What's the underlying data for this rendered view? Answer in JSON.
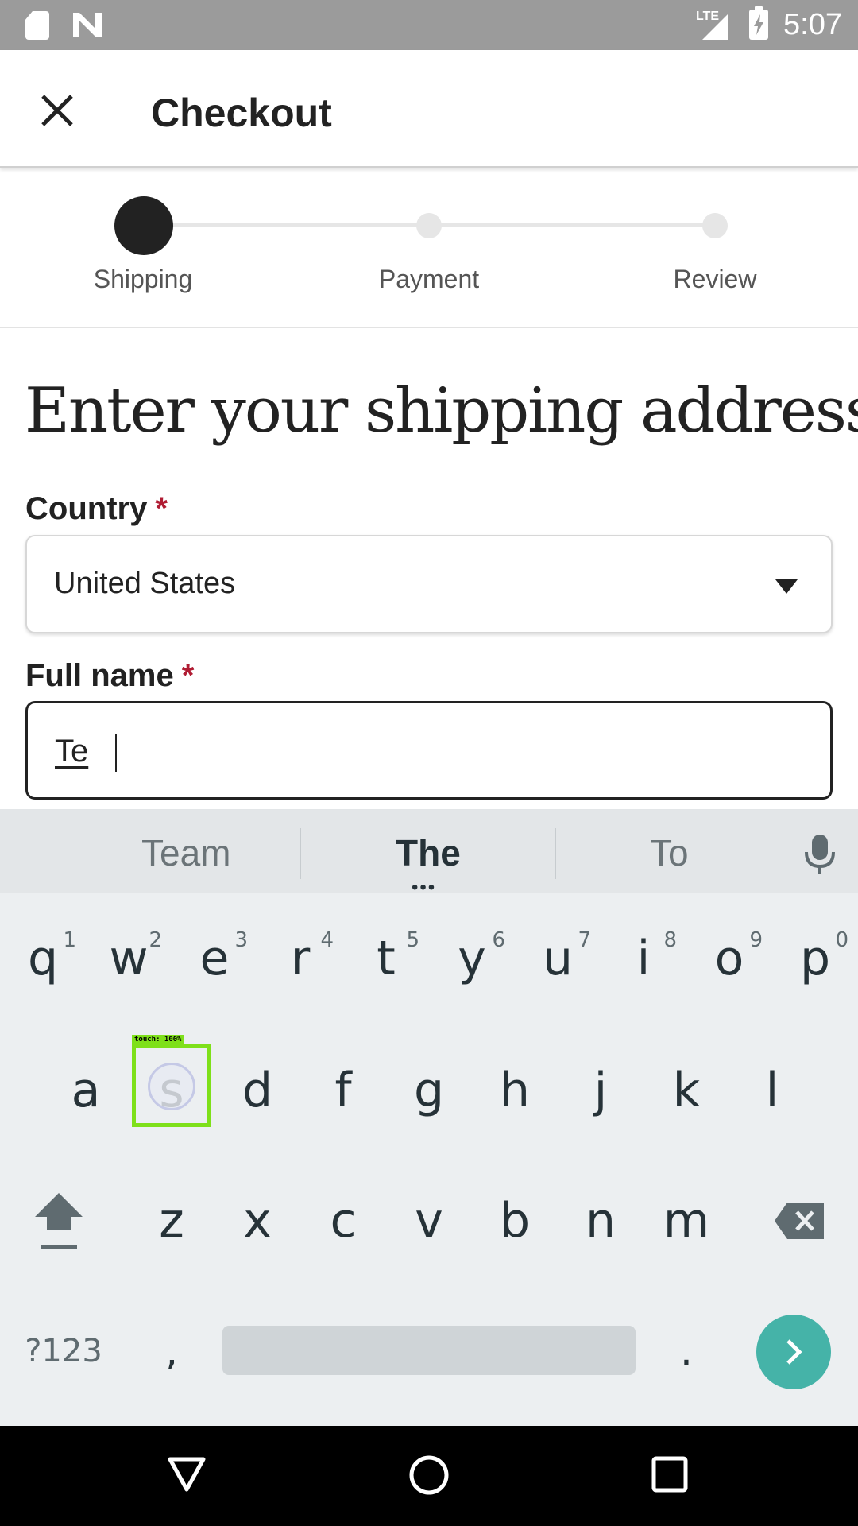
{
  "status_bar": {
    "network": "LTE",
    "time": "5:07",
    "icons": [
      "sd-card-icon",
      "n-notification-icon",
      "signal-icon",
      "battery-charging-icon"
    ]
  },
  "app_bar": {
    "title": "Checkout",
    "close_icon": "close-icon"
  },
  "stepper": {
    "steps": [
      {
        "label": "Shipping",
        "active": true
      },
      {
        "label": "Payment",
        "active": false
      },
      {
        "label": "Review",
        "active": false
      }
    ]
  },
  "form": {
    "heading": "Enter your shipping address",
    "country": {
      "label": "Country",
      "required_mark": "*",
      "value": "United States"
    },
    "full_name": {
      "label": "Full name",
      "required_mark": "*",
      "value": "Te"
    }
  },
  "keyboard": {
    "suggestions": [
      "Team",
      "The",
      "To"
    ],
    "suggestion_more": "•••",
    "row1": [
      {
        "key": "q",
        "hint": "1"
      },
      {
        "key": "w",
        "hint": "2"
      },
      {
        "key": "e",
        "hint": "3"
      },
      {
        "key": "r",
        "hint": "4"
      },
      {
        "key": "t",
        "hint": "5"
      },
      {
        "key": "y",
        "hint": "6"
      },
      {
        "key": "u",
        "hint": "7"
      },
      {
        "key": "i",
        "hint": "8"
      },
      {
        "key": "o",
        "hint": "9"
      },
      {
        "key": "p",
        "hint": "0"
      }
    ],
    "row2": [
      "a",
      "s",
      "d",
      "f",
      "g",
      "h",
      "j",
      "k",
      "l"
    ],
    "row3": [
      "z",
      "x",
      "c",
      "v",
      "b",
      "n",
      "m"
    ],
    "symbols_label": "?123",
    "comma": ",",
    "period": ".",
    "touch_tag": "touch: 100%",
    "accent_color": "#45b3a8",
    "touch_color": "#7ee01a"
  },
  "nav_bar": {
    "icons": [
      "back-icon",
      "home-icon",
      "recents-icon"
    ]
  }
}
